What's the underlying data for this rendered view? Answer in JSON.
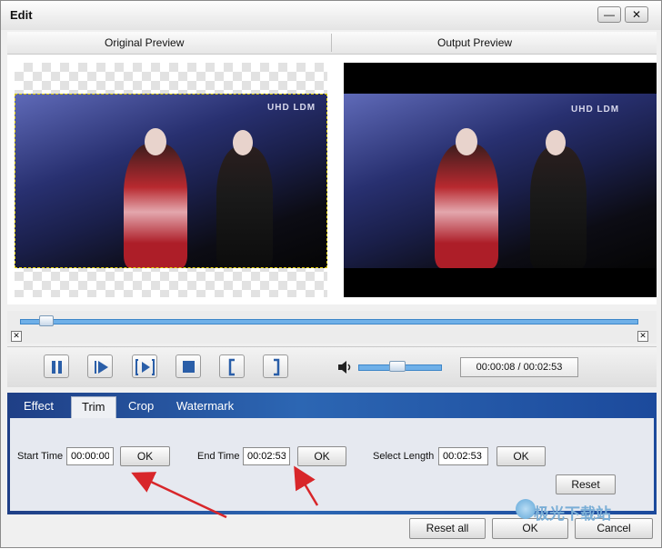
{
  "window": {
    "title": "Edit",
    "minimize_glyph": "—",
    "close_glyph": "✕"
  },
  "preview": {
    "original_label": "Original Preview",
    "output_label": "Output Preview",
    "video_logo": "UHD LDM"
  },
  "playback": {
    "time_display": "00:00:08 / 00:02:53",
    "buttons": [
      "pause-icon",
      "next-frame-icon",
      "play-segment-icon",
      "stop-icon",
      "mark-in-icon",
      "mark-out-icon"
    ],
    "volume_icon": "speaker-icon",
    "progress_fraction": 0.05,
    "volume_fraction": 0.5
  },
  "tabs": {
    "effect": "Effect",
    "trim": "Trim",
    "crop": "Crop",
    "watermark": "Watermark",
    "active": "Trim"
  },
  "trim": {
    "start_label": "Start Time",
    "start_value": "00:00:00",
    "start_ok": "OK",
    "end_label": "End Time",
    "end_value": "00:02:53",
    "end_ok": "OK",
    "length_label": "Select Length",
    "length_value": "00:02:53",
    "length_ok": "OK",
    "reset": "Reset"
  },
  "footer": {
    "reset_all": "Reset all",
    "ok": "OK",
    "cancel": "Cancel"
  },
  "watermark_text": "极光下载站",
  "colors": {
    "panel_blue": "#2c66b3",
    "accent_arrow": "#d8262a",
    "track_blue": "#6fb0e8"
  }
}
